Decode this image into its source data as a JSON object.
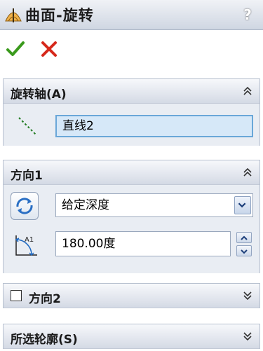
{
  "title_bar": {
    "title": "曲面-旋转",
    "help": "?"
  },
  "groups": {
    "axis": {
      "title": "旋转轴(A)",
      "field_value": "直线2"
    },
    "direction1": {
      "title": "方向1",
      "end_condition": "给定深度",
      "angle": "180.00度"
    },
    "direction2": {
      "title": "方向2",
      "checked": false
    },
    "contours": {
      "title": "所选轮廓(S)"
    }
  },
  "colors": {
    "ok": "#3a9a1c",
    "cancel": "#d6291c",
    "field_highlight": "#d6e8f8"
  }
}
